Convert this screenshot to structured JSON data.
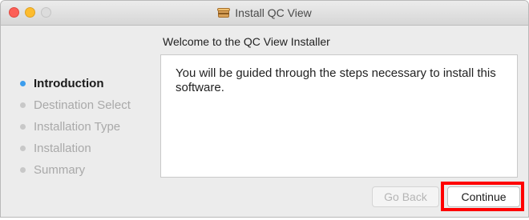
{
  "window": {
    "title": "Install QC View",
    "icon": "package-icon"
  },
  "main": {
    "heading": "Welcome to the QC View Installer",
    "body_text": "You will be guided through the steps necessary to install this software."
  },
  "sidebar": {
    "steps": [
      {
        "label": "Introduction",
        "active": true
      },
      {
        "label": "Destination Select",
        "active": false
      },
      {
        "label": "Installation Type",
        "active": false
      },
      {
        "label": "Installation",
        "active": false
      },
      {
        "label": "Summary",
        "active": false
      }
    ]
  },
  "buttons": {
    "back_label": "Go Back",
    "back_enabled": false,
    "continue_label": "Continue"
  },
  "colors": {
    "active_step_dot": "#3c9ded",
    "highlight": "#ff0000"
  }
}
